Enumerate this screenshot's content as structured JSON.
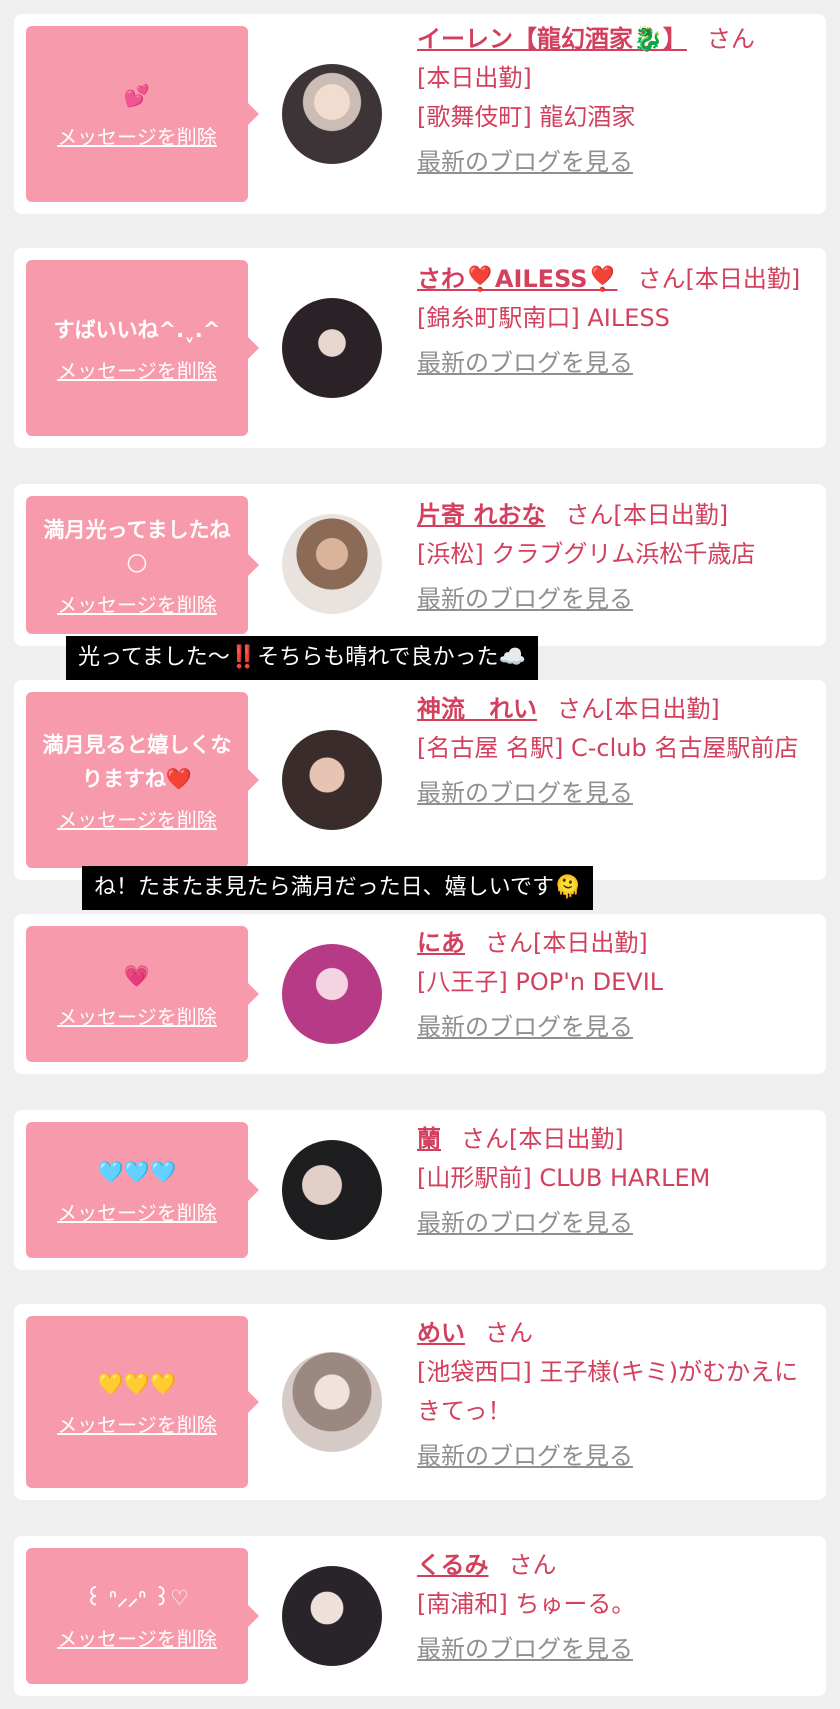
{
  "delete_label": "メッセージを削除",
  "blog_label": "最新のブログを見る",
  "san_label": "さん",
  "cards": [
    {
      "msg": "💕",
      "name": "イーレン【龍幻酒家🐉】",
      "rest": "さん",
      "lines": [
        "[本日出勤]",
        "[歌舞伎町] 龍幻酒家"
      ]
    },
    {
      "msg": "すばいいね^.ˬ.^",
      "name": "さわ❣️AILESS❣️",
      "rest": "さん[本日出勤]",
      "lines": [
        "[錦糸町駅南口] AILESS"
      ]
    },
    {
      "msg": "満月光ってましたね🌕",
      "name": "片寄 れおな",
      "rest": "さん[本日出勤]",
      "lines": [
        "[浜松] クラブグリム浜松千歳店"
      ]
    },
    {
      "msg": "満月見ると嬉しくなりますね❤️",
      "name": "神流　れい",
      "rest": "さん[本日出勤]",
      "lines": [
        "[名古屋 名駅] C-club 名古屋駅前店"
      ]
    },
    {
      "msg": "💗",
      "name": "にあ",
      "rest": "さん[本日出勤]",
      "lines": [
        "[八王子] POP'n DEVIL"
      ]
    },
    {
      "msg": "🩵🩵🩵",
      "name": "蘭",
      "rest": "さん[本日出勤]",
      "lines": [
        "[山形駅前] CLUB HARLEM"
      ]
    },
    {
      "msg": "💛💛💛",
      "name": "めい",
      "rest": "さん",
      "lines": [
        "[池袋西口] 王子様(キミ)がむかえにきてっ！"
      ]
    },
    {
      "msg": "꒰ ᐢ⸝⸝ᐢ ꒱♡",
      "name": "くるみ",
      "rest": "さん",
      "lines": [
        "[南浦和] ちゅーる。"
      ]
    }
  ],
  "captions": [
    "光ってました〜‼️そちらも晴れで良かった☁️",
    "ね！たまたま見たら満月だった日、嬉しいです🫠"
  ],
  "colors": {
    "accent": "#d3405d",
    "bubble": "#f79aac",
    "background": "#efefef",
    "link_gray": "#8f8f8f"
  }
}
